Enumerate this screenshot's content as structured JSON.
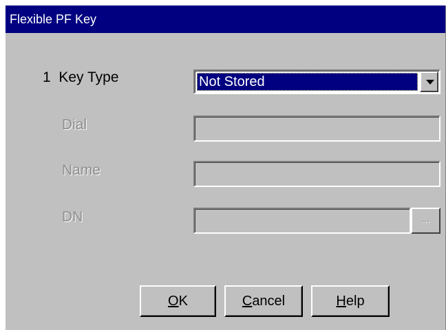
{
  "window": {
    "title": "Flexible PF Key"
  },
  "form": {
    "key_type": {
      "label": "1  Key Type",
      "value": "Not Stored"
    },
    "dial": {
      "label": "Dial",
      "value": ""
    },
    "name": {
      "label": "Name",
      "value": ""
    },
    "dn": {
      "label": "DN",
      "value": "",
      "browse_label": "..."
    }
  },
  "buttons": {
    "ok": {
      "mnemonic": "O",
      "rest": "K"
    },
    "cancel": {
      "mnemonic": "C",
      "rest": "ancel"
    },
    "help": {
      "mnemonic": "H",
      "rest": "elp"
    }
  },
  "colors": {
    "title_bar": "#000080",
    "face": "#c0c0c0",
    "selection": "#000080",
    "disabled_text": "#8e8e8e"
  },
  "icons": {
    "combo_arrow": "chevron-down-icon"
  }
}
